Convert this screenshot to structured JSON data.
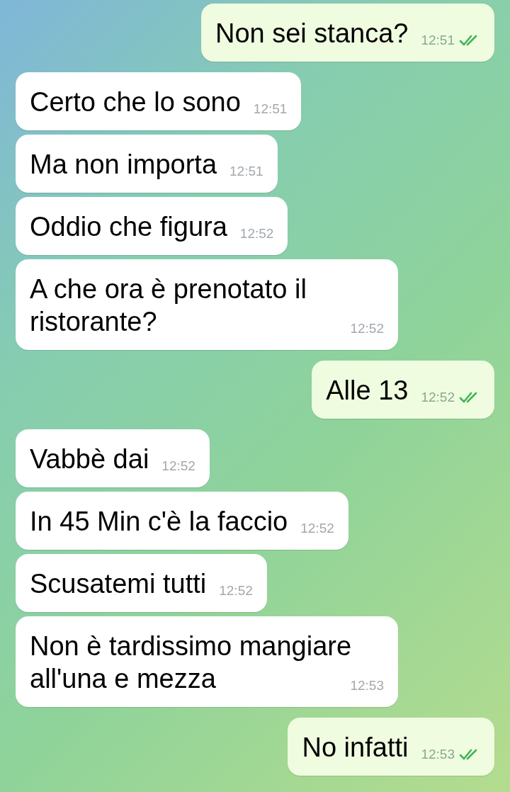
{
  "messages": [
    {
      "kind": "outgoing",
      "text": "Non sei stanca?",
      "time": "12:51",
      "read": true
    },
    {
      "kind": "incoming",
      "text": "Certo che lo sono",
      "time": "12:51"
    },
    {
      "kind": "incoming",
      "text": "Ma non importa",
      "time": "12:51"
    },
    {
      "kind": "incoming",
      "text": "Oddio che figura",
      "time": "12:52"
    },
    {
      "kind": "incoming",
      "text": "A che ora è prenotato il ristorante?",
      "time": "12:52"
    },
    {
      "kind": "outgoing",
      "text": "Alle 13",
      "time": "12:52",
      "read": true
    },
    {
      "kind": "incoming",
      "text": "Vabbè dai",
      "time": "12:52"
    },
    {
      "kind": "incoming",
      "text": "In 45 Min c'è la faccio",
      "time": "12:52"
    },
    {
      "kind": "incoming",
      "text": "Scusatemi tutti",
      "time": "12:52"
    },
    {
      "kind": "incoming",
      "text": "Non è tardissimo mangiare all'una e mezza",
      "time": "12:53"
    },
    {
      "kind": "outgoing",
      "text": "No infatti",
      "time": "12:53",
      "read": true
    }
  ]
}
